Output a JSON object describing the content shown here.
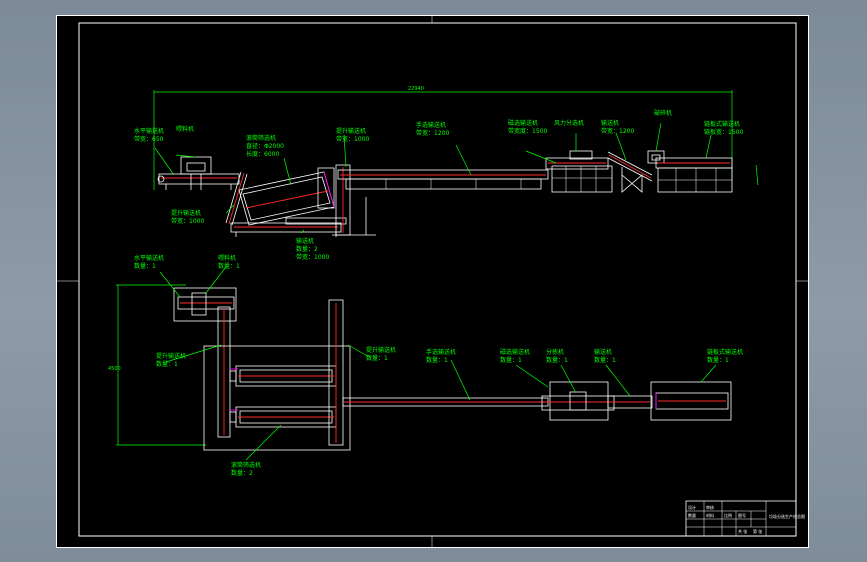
{
  "drawing": {
    "overall_dim": "22940",
    "plan_dim": "4500",
    "elevation_labels": [
      {
        "id": "e1",
        "lines": [
          "水平输送机",
          "带宽：650"
        ]
      },
      {
        "id": "e2",
        "lines": [
          "喂料机"
        ]
      },
      {
        "id": "e3",
        "lines": [
          "滚筒筛选机",
          "直径：Φ2000",
          "长度：6000"
        ]
      },
      {
        "id": "e4",
        "lines": [
          "提升输送机",
          "带宽：1000"
        ]
      },
      {
        "id": "e5",
        "lines": [
          "手选输送机",
          "带宽：1200"
        ]
      },
      {
        "id": "e6",
        "lines": [
          "磁选输送机",
          "带宽度：1500"
        ]
      },
      {
        "id": "e7",
        "lines": [
          "风力分选机"
        ]
      },
      {
        "id": "e8",
        "lines": [
          "输送机",
          "带宽：1200"
        ]
      },
      {
        "id": "e9",
        "lines": [
          "破碎机"
        ]
      },
      {
        "id": "e10",
        "lines": [
          "链板式输送机",
          "链板宽：1500"
        ]
      },
      {
        "id": "e11",
        "lines": [
          "提升输送机",
          "带宽：1000"
        ]
      },
      {
        "id": "e12",
        "lines": [
          "输送机",
          "数量：2",
          "带宽：1000"
        ]
      }
    ],
    "plan_labels": [
      {
        "id": "p1",
        "lines": [
          "水平输送机",
          "数量：1"
        ]
      },
      {
        "id": "p2",
        "lines": [
          "喂料机",
          "数量：1"
        ]
      },
      {
        "id": "p3",
        "lines": [
          "提升输送机",
          "数量：1"
        ]
      },
      {
        "id": "p4",
        "lines": [
          "提升输送机",
          "数量：1"
        ]
      },
      {
        "id": "p5",
        "lines": [
          "手选输送机",
          "数量：1"
        ]
      },
      {
        "id": "p6",
        "lines": [
          "磁选输送机",
          "数量：1"
        ]
      },
      {
        "id": "p7",
        "lines": [
          "分拣机",
          "数量：1"
        ]
      },
      {
        "id": "p8",
        "lines": [
          "输送机",
          "数量：1"
        ]
      },
      {
        "id": "p9",
        "lines": [
          "链板式输送机",
          "数量：1"
        ]
      },
      {
        "id": "p10",
        "lines": [
          "滚筒筛选机",
          "数量：2"
        ]
      }
    ],
    "title_block": {
      "drawing_title": "垃圾分选生产线总图",
      "cells": [
        "设计",
        "审核",
        "比例",
        "图号",
        "共 张",
        "第 张",
        "数量",
        "材料"
      ]
    }
  },
  "colors": {
    "annotation": "#00ff00",
    "outline": "#ffffff",
    "belt": "#ff2a2a",
    "accent": "#ff00ff",
    "background": "#000000",
    "window": "#8a97a6"
  }
}
